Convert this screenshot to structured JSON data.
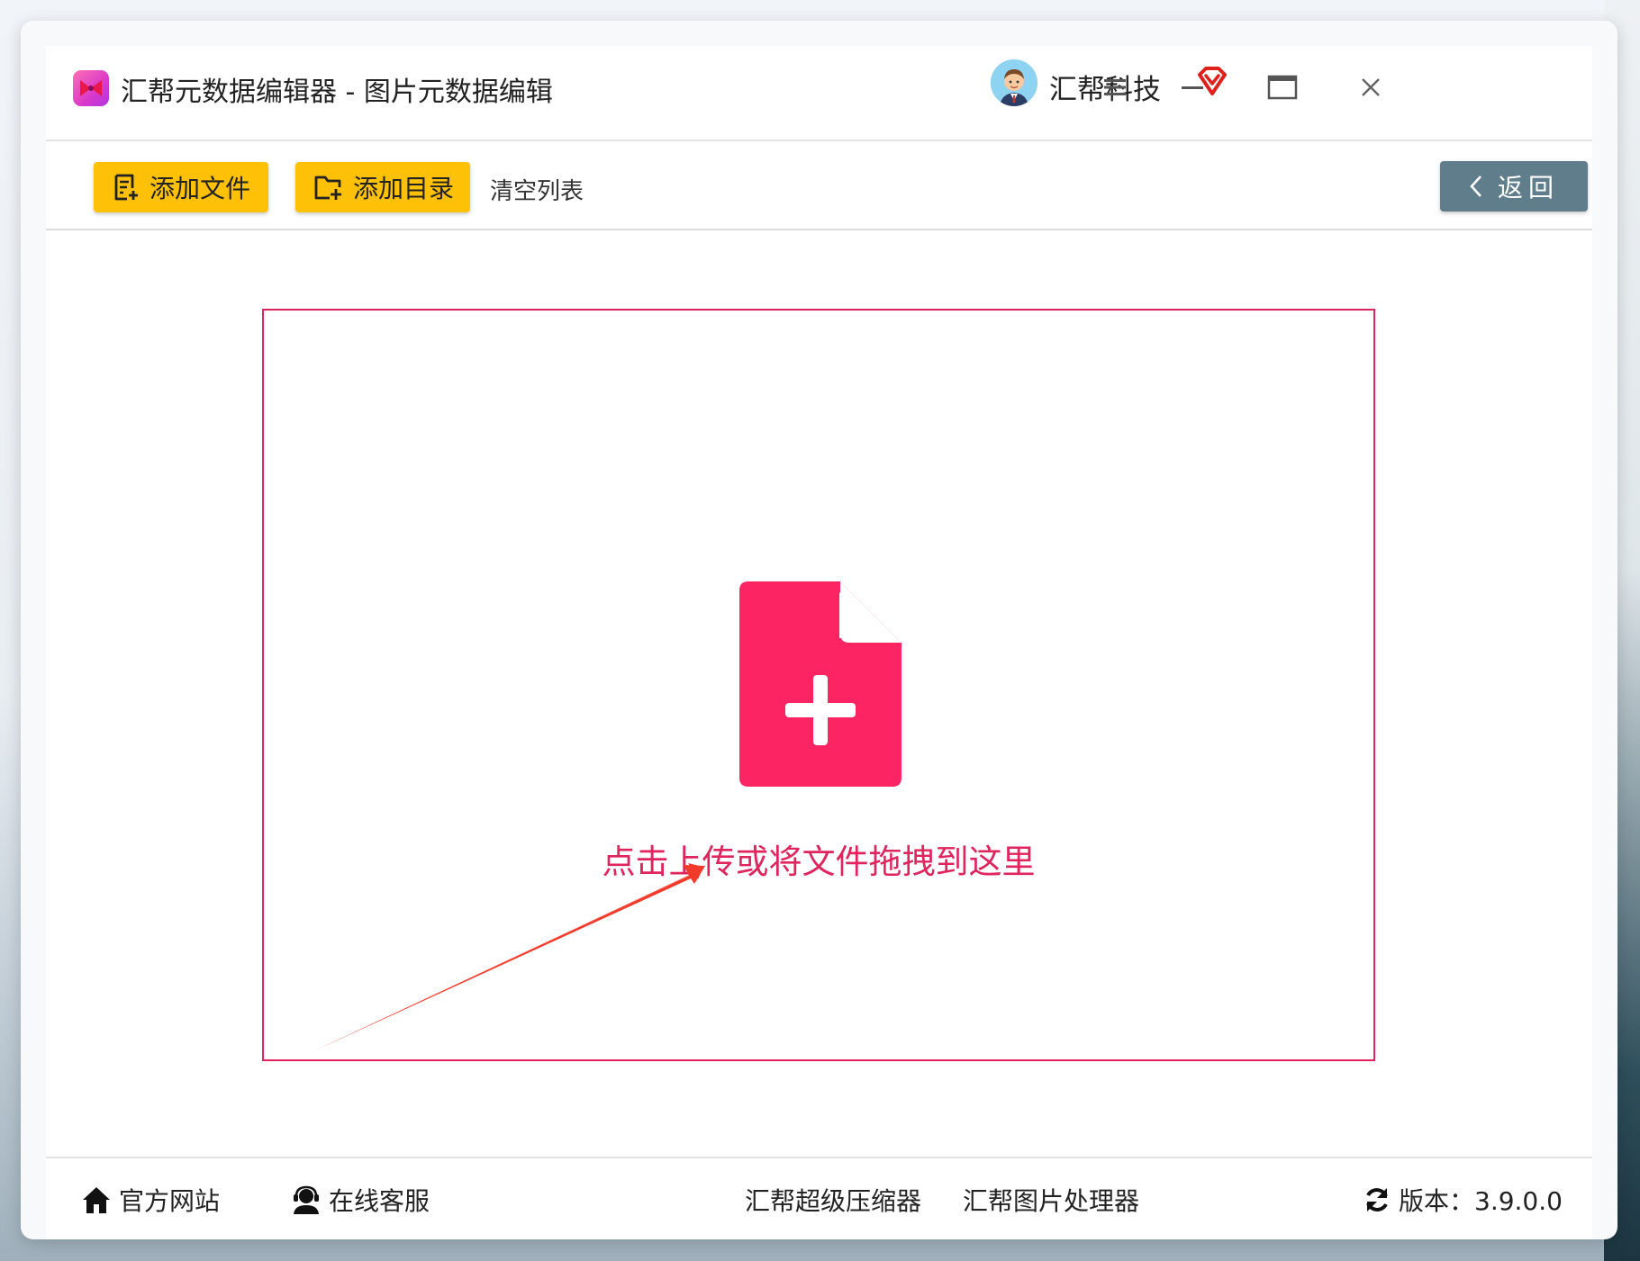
{
  "app": {
    "title": "汇帮元数据编辑器 - 图片元数据编辑",
    "user_name": "汇帮科技"
  },
  "toolbar": {
    "add_file_label": "添加文件",
    "add_dir_label": "添加目录",
    "clear_label": "清空列表",
    "back_label": "返回"
  },
  "dropzone": {
    "hint": "点击上传或将文件拖拽到这里"
  },
  "footer": {
    "website_label": "官方网站",
    "support_label": "在线客服",
    "compressor_label": "汇帮超级压缩器",
    "image_tool_label": "汇帮图片处理器",
    "version_label": "版本：3.9.0.0"
  },
  "colors": {
    "accent_pink": "#e0245e",
    "button_yellow": "#ffc107",
    "back_button": "#607d8b",
    "vip_red": "#e0201b"
  },
  "icons": [
    "app-logo-icon",
    "avatar",
    "vip-diamond-icon",
    "menu-icon",
    "minimize-icon",
    "maximize-icon",
    "close-icon",
    "add-file-icon",
    "add-folder-icon",
    "chevron-left-icon",
    "file-plus-icon",
    "home-icon",
    "support-agent-icon",
    "refresh-icon"
  ]
}
